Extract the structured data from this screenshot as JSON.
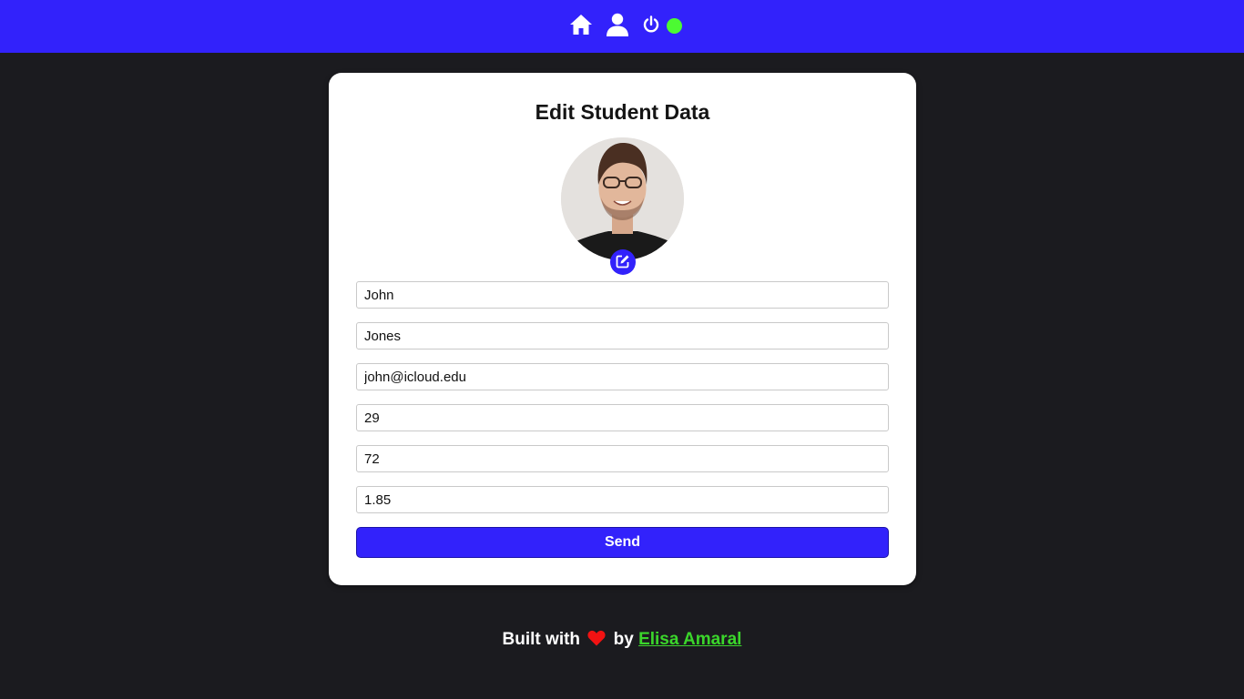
{
  "nav": {
    "icons": [
      "home-icon",
      "user-icon",
      "power-icon"
    ],
    "status_color": "#4cfa32",
    "bar_color": "#3222fb"
  },
  "form": {
    "title": "Edit Student Data",
    "edit_photo_icon": "edit-icon",
    "fields": [
      {
        "value": "John"
      },
      {
        "value": "Jones"
      },
      {
        "value": "john@icloud.edu"
      },
      {
        "value": "29"
      },
      {
        "value": "72"
      },
      {
        "value": "1.85"
      }
    ],
    "send_label": "Send"
  },
  "footer": {
    "prefix": "Built with",
    "heart_icon": "heart-icon",
    "by": "by",
    "author": "Elisa Amaral",
    "author_color": "#3bd62b"
  }
}
